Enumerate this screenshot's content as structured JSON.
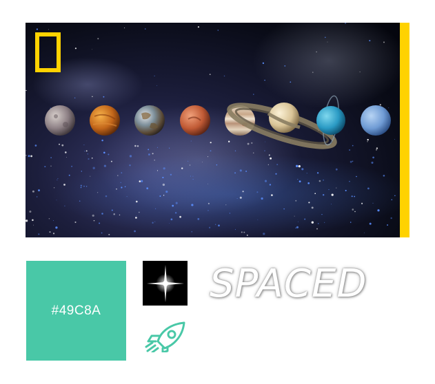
{
  "hero": {
    "planets": [
      {
        "icon": "mercury-icon"
      },
      {
        "icon": "venus-icon"
      },
      {
        "icon": "earth-icon"
      },
      {
        "icon": "mars-icon"
      },
      {
        "icon": "jupiter-icon"
      },
      {
        "icon": "saturn-icon"
      },
      {
        "icon": "uranus-icon"
      },
      {
        "icon": "neptune-icon"
      }
    ]
  },
  "palette": {
    "swatch_label": "#49C8A",
    "swatch_color": "#49C8A7",
    "accent_color": "#FFD200"
  },
  "brand": {
    "wordmark": "SPACED"
  },
  "icons": {
    "logo": "yellow-frame-logo-icon",
    "star": "star-flare-icon",
    "rocket": "rocket-icon"
  }
}
